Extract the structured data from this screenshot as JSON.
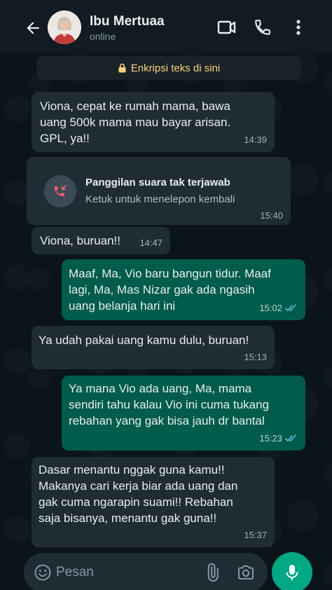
{
  "header": {
    "title": "Ibu Mertuaa",
    "status": "online"
  },
  "encryption": {
    "label": "Enkripsi teks di sini"
  },
  "messages": [
    {
      "text": "Viona, cepat ke rumah mama, bawa\nuang 500k mama mau bayar arisan.\nGPL, ya!!",
      "time": "14:39",
      "direction": "incoming"
    },
    {
      "text": "Viona, buruan!!",
      "time": "14:47",
      "direction": "incoming"
    },
    {
      "text": "Maaf, Ma, Vio baru bangun tidur. Maaf\nlagi, Ma, Mas Nizar gak ada ngasih\nuang belanja hari ini",
      "time": "15:02",
      "direction": "outgoing",
      "read": true
    },
    {
      "text": "Ya udah pakai uang kamu dulu, buruan!",
      "time": "15:13",
      "direction": "incoming"
    },
    {
      "text": "Ya mana Vio ada uang, Ma, mama\nsendiri tahu kalau Vio ini cuma tukang\nrebahan yang gak bisa jauh dr bantal",
      "time": "15:23",
      "direction": "outgoing",
      "read": true
    },
    {
      "text": "Dasar menantu nggak guna kamu!!\nMakanya cari kerja biar ada uang dan\ngak cuma ngarapin suami!! Rebahan\nsaja bisanya,  menantu gak guna!!",
      "time": "15:37",
      "direction": "incoming"
    }
  ],
  "missed_call": {
    "title": "Panggilan suara tak terjawab",
    "subtitle": "Ketuk untuk menelepon kembali",
    "time": "15:40"
  },
  "input": {
    "placeholder": "Pesan"
  },
  "colors": {
    "header_bg": "#111b21",
    "incoming_bubble": "#202c33",
    "outgoing_bubble": "#005c4b",
    "accent": "#00a884",
    "read_ticks": "#53bdeb"
  }
}
